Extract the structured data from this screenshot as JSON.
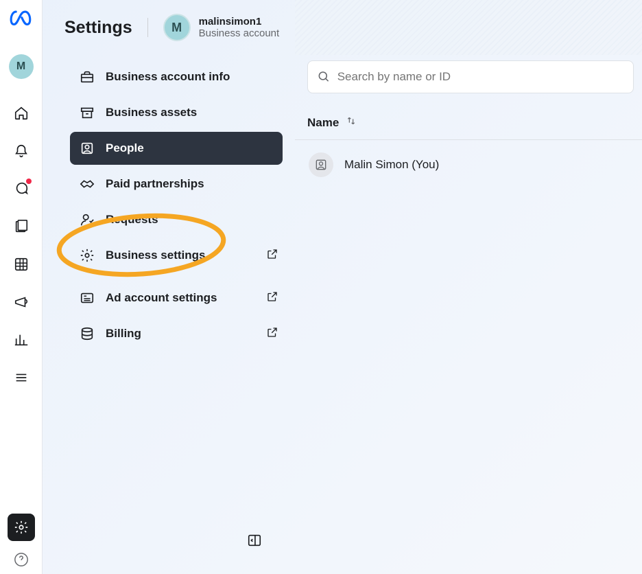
{
  "pageTitle": "Settings",
  "account": {
    "name": "malinsimon1",
    "sub": "Business account",
    "avatarLetter": "M"
  },
  "railAvatar": "M",
  "nav": {
    "items": [
      {
        "label": "Business account info"
      },
      {
        "label": "Business assets"
      },
      {
        "label": "People",
        "active": true
      },
      {
        "label": "Paid partnerships"
      },
      {
        "label": "Requests"
      },
      {
        "label": "Business settings",
        "external": true
      },
      {
        "label": "Ad account settings",
        "external": true
      },
      {
        "label": "Billing",
        "external": true
      }
    ]
  },
  "search": {
    "placeholder": "Search by name or ID"
  },
  "table": {
    "columnName": "Name",
    "rows": [
      {
        "name": "Malin Simon (You)"
      }
    ]
  },
  "annotation": {
    "color": "#f5a623",
    "target": "Business settings"
  }
}
